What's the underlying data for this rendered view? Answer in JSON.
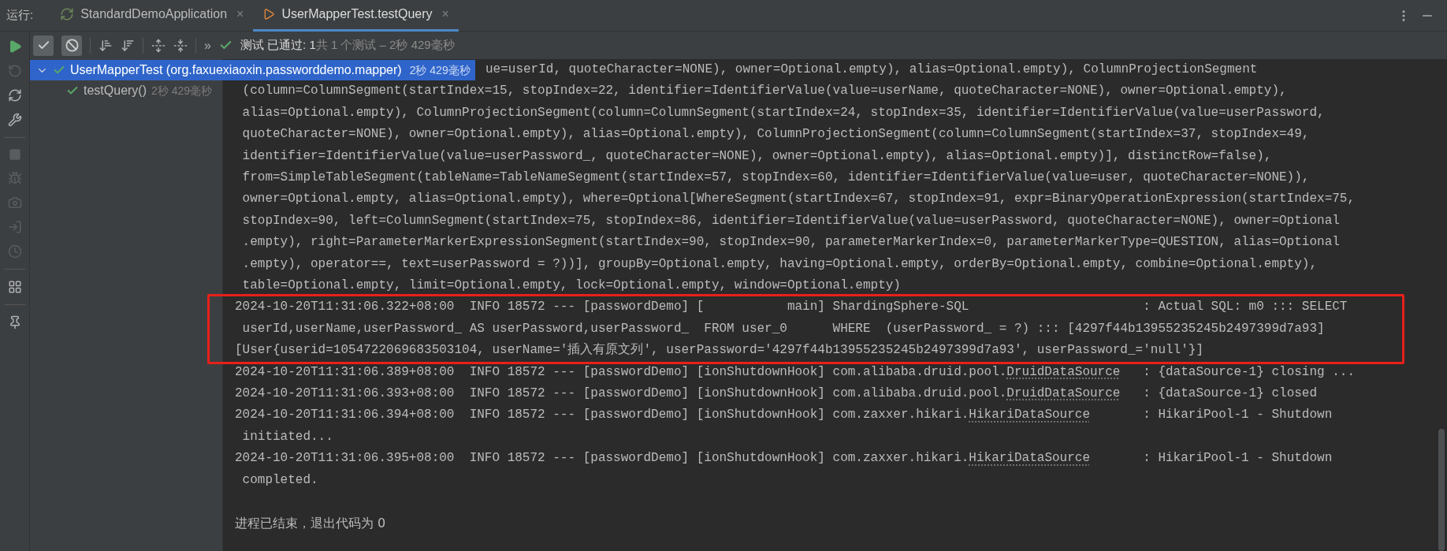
{
  "run_label": "运行:",
  "tabs": [
    {
      "label": "StandardDemoApplication",
      "close": "×",
      "selected": false
    },
    {
      "label": "UserMapperTest.testQuery",
      "close": "×",
      "selected": true
    }
  ],
  "toolbar": {
    "toggles": [
      {
        "kind": "passed",
        "selected": true
      },
      {
        "kind": "ignored",
        "selected": true
      }
    ],
    "more": "»",
    "status": {
      "passed": "测试 已通过: 1",
      "summary": "共 1 个测试 – 2秒 429毫秒"
    }
  },
  "tree": [
    {
      "label": "UserMapperTest (org.faxuexiaoxin.passworddemo.mapper)",
      "time": "2秒 429毫秒",
      "selected": true,
      "expanded": true,
      "children": [
        {
          "label": "testQuery()",
          "time": "2秒 429毫秒",
          "selected": false
        }
      ]
    }
  ],
  "console": {
    "blocks": [
      {
        "highlighted": false,
        "lines": [
          {
            "kind": "covered",
            "text": "ue=userId, quoteCharacter=NONE), owner=Optional.empty), alias=Optional.empty), ColumnProjectionSegment"
          },
          {
            "kind": "log",
            "text": " (column=ColumnSegment(startIndex=15, stopIndex=22, identifier=IdentifierValue(value=userName, quoteCharacter=NONE), owner=Optional.empty),"
          },
          {
            "kind": "log",
            "text": " alias=Optional.empty), ColumnProjectionSegment(column=ColumnSegment(startIndex=24, stopIndex=35, identifier=IdentifierValue(value=userPassword,"
          },
          {
            "kind": "log",
            "text": " quoteCharacter=NONE), owner=Optional.empty), alias=Optional.empty), ColumnProjectionSegment(column=ColumnSegment(startIndex=37, stopIndex=49,"
          },
          {
            "kind": "log",
            "text": " identifier=IdentifierValue(value=userPassword_, quoteCharacter=NONE), owner=Optional.empty), alias=Optional.empty)], distinctRow=false),"
          },
          {
            "kind": "log",
            "text": " from=SimpleTableSegment(tableName=TableNameSegment(startIndex=57, stopIndex=60, identifier=IdentifierValue(value=user, quoteCharacter=NONE)),"
          },
          {
            "kind": "log",
            "text": " owner=Optional.empty, alias=Optional.empty), where=Optional[WhereSegment(startIndex=67, stopIndex=91, expr=BinaryOperationExpression(startIndex=75,"
          },
          {
            "kind": "log",
            "text": " stopIndex=90, left=ColumnSegment(startIndex=75, stopIndex=86, identifier=IdentifierValue(value=userPassword, quoteCharacter=NONE), owner=Optional"
          },
          {
            "kind": "log",
            "text": " .empty), right=ParameterMarkerExpressionSegment(startIndex=90, stopIndex=90, parameterMarkerIndex=0, parameterMarkerType=QUESTION, alias=Optional"
          },
          {
            "kind": "log",
            "text": " .empty), operator==, text=userPassword = ?))], groupBy=Optional.empty, having=Optional.empty, orderBy=Optional.empty, combine=Optional.empty),"
          },
          {
            "kind": "log",
            "text": " table=Optional.empty, limit=Optional.empty, lock=Optional.empty, window=Optional.empty)"
          }
        ]
      },
      {
        "highlighted": true,
        "lines": [
          {
            "kind": "log",
            "text": "2024-10-20T11:31:06.322+08:00  INFO 18572 --- [passwordDemo] [           main] ShardingSphere-SQL                       : Actual SQL: m0 ::: SELECT"
          },
          {
            "kind": "log",
            "text": " userId,userName,userPassword_ AS userPassword,userPassword_  FROM user_0      WHERE  (userPassword_ = ?) ::: [4297f44b13955235245b2497399d7a93]"
          },
          {
            "kind": "log",
            "text": "[User{userid=1054722069683503104, userName='插入有原文列', userPassword='4297f44b13955235245b2497399d7a93', userPassword_='null'}]"
          }
        ]
      },
      {
        "highlighted": false,
        "lines": [
          {
            "kind": "log",
            "parts": [
              {
                "text": "2024-10-20T11:31:06.389+08:00  INFO 18572 --- [passwordDemo] [ionShutdownHook] com.alibaba.druid.pool."
              },
              {
                "text": "DruidDataSource",
                "link": true
              },
              {
                "text": "   : {dataSource-1} closing ..."
              }
            ]
          },
          {
            "kind": "log",
            "parts": [
              {
                "text": "2024-10-20T11:31:06.393+08:00  INFO 18572 --- [passwordDemo] [ionShutdownHook] com.alibaba.druid.pool."
              },
              {
                "text": "DruidDataSource",
                "link": true
              },
              {
                "text": "   : {dataSource-1} closed"
              }
            ]
          },
          {
            "kind": "log",
            "parts": [
              {
                "text": "2024-10-20T11:31:06.394+08:00  INFO 18572 --- [passwordDemo] [ionShutdownHook] com.zaxxer.hikari."
              },
              {
                "text": "HikariDataSource",
                "link": true
              },
              {
                "text": "       : HikariPool-1 - Shutdown"
              }
            ]
          },
          {
            "kind": "log",
            "text": " initiated..."
          },
          {
            "kind": "log",
            "parts": [
              {
                "text": "2024-10-20T11:31:06.395+08:00  INFO 18572 --- [passwordDemo] [ionShutdownHook] com.zaxxer.hikari."
              },
              {
                "text": "HikariDataSource",
                "link": true
              },
              {
                "text": "       : HikariPool-1 - Shutdown"
              }
            ]
          },
          {
            "kind": "log",
            "text": " completed."
          },
          {
            "kind": "exit",
            "text": "进程已结束，退出代码为 0"
          }
        ]
      }
    ]
  }
}
